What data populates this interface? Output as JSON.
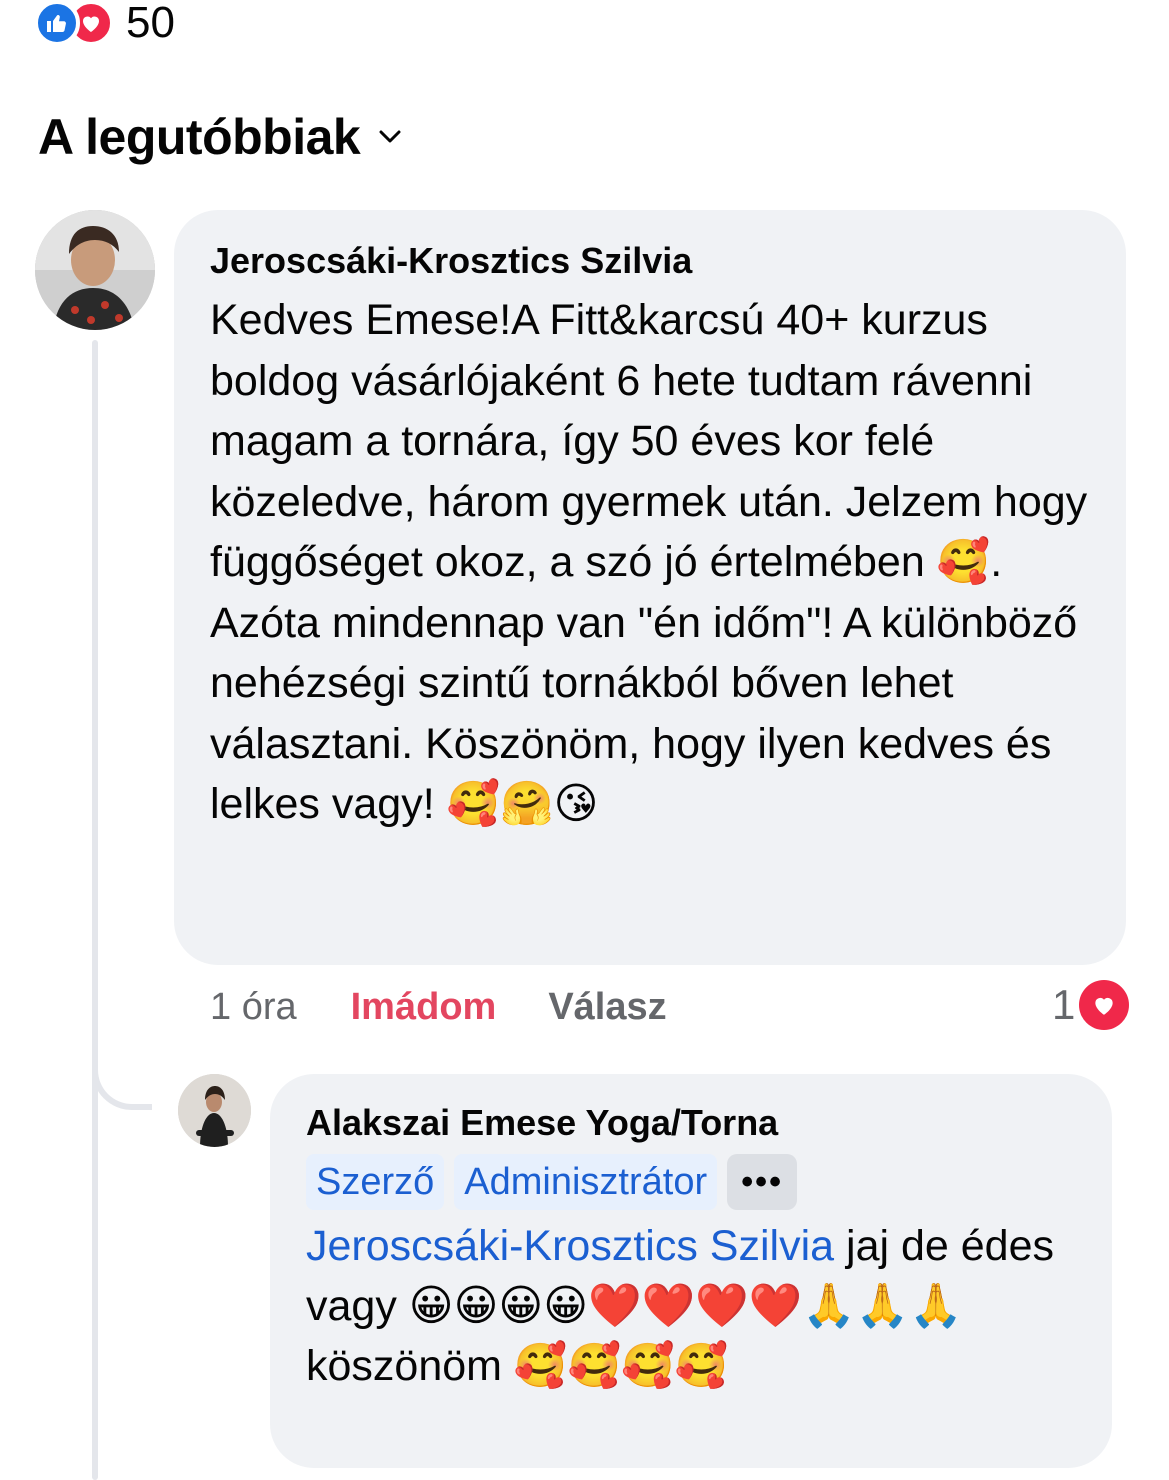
{
  "reactions": {
    "count": "50",
    "types": [
      "like-icon",
      "love-icon"
    ]
  },
  "sort": {
    "label": "A legutóbbiak"
  },
  "comment": {
    "author": "Jeroscsáki-Krosztics Szilvia",
    "text": "Kedves Emese!A Fitt&karcsú 40+ kurzus boldog vásárlójaként 6 hete tudtam rávenni magam a tornára, így 50 éves kor  felé közeledve, három gyermek után. Jelzem hogy függőséget okoz, a szó jó értelmében 🥰. Azóta mindennap van \"én időm\"! A különböző nehézségi szintű tornákból bőven lehet választani. Köszönöm, hogy ilyen kedves és lelkes vagy! 🥰🤗😘",
    "time": "1 óra",
    "love_label": "Imádom",
    "reply_label": "Válasz",
    "reaction_count": "1"
  },
  "reply": {
    "author": "Alakszai Emese Yoga/Torna",
    "badges": [
      "Szerző",
      "Adminisztrátor"
    ],
    "more": "•••",
    "mention": "Jeroscsáki-Krosztics Szilvia",
    "text": " jaj de édes vagy 😀😀😀😀❤️❤️❤️❤️🙏🙏🙏 köszönöm 🥰🥰🥰🥰"
  },
  "colors": {
    "like": "#1b74e4",
    "love": "#f0284a",
    "link": "#1b5fd1",
    "bubble": "#f0f2f5"
  }
}
